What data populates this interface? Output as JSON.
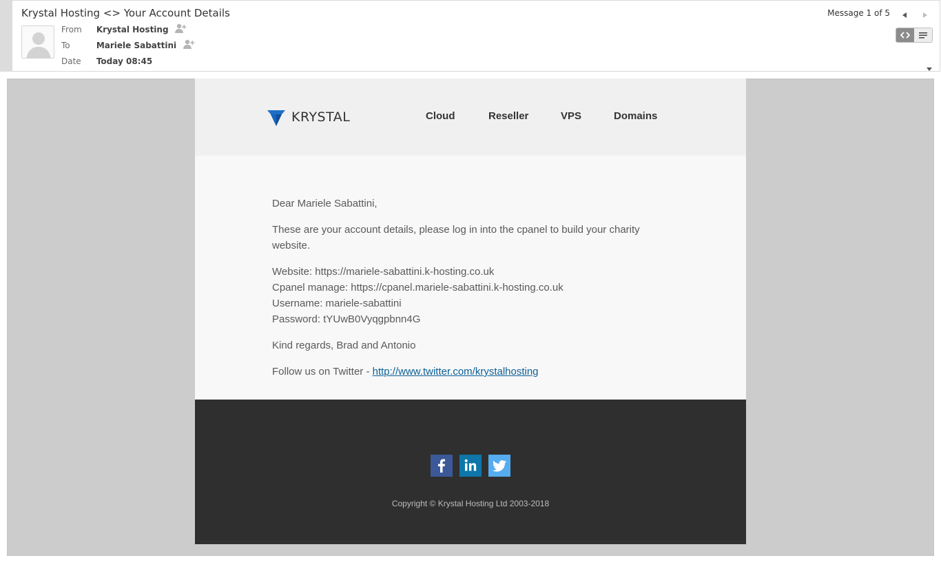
{
  "header": {
    "subject": "Krystal Hosting <> Your Account Details",
    "from_label": "From",
    "from_value": "Krystal Hosting",
    "to_label": "To",
    "to_value": "Mariele Sabattini",
    "date_label": "Date",
    "date_value": "Today 08:45",
    "message_counter": "Message 1 of 5"
  },
  "email": {
    "logo_text": "KRYSTAL",
    "nav": [
      "Cloud",
      "Reseller",
      "VPS",
      "Domains"
    ],
    "greeting": "Dear Mariele Sabattini,",
    "intro": "These are your account details, please log in into the cpanel to build your charity website.",
    "details": [
      "Website: https://mariele-sabattini.k-hosting.co.uk",
      "Cpanel manage: https://cpanel.mariele-sabattini.k-hosting.co.uk",
      "Username: mariele-sabattini",
      "Password: tYUwB0Vyqgpbnn4G"
    ],
    "regards": "Kind regards, Brad and Antonio",
    "follow_prefix": "Follow us on Twitter - ",
    "twitter_link": "http://www.twitter.com/krystalhosting",
    "copyright": "Copyright © Krystal Hosting Ltd 2003-2018"
  },
  "colors": {
    "logo_blue": "#1565c0",
    "facebook": "#3b5998",
    "linkedin": "#0e76a8",
    "twitter": "#55acee",
    "footer_bg": "#2f2f2f",
    "link": "#0b5f96"
  }
}
